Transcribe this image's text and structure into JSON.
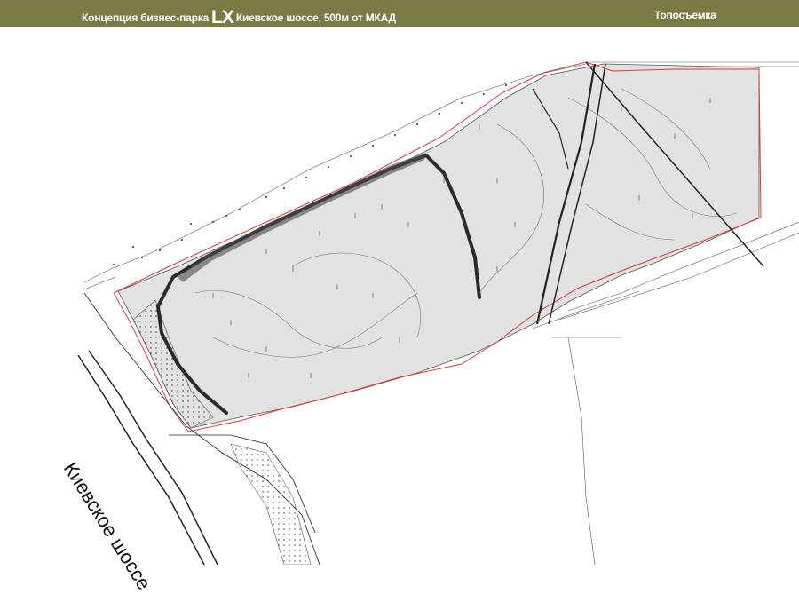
{
  "header": {
    "title_before": "Концепция бизнес-парка",
    "title_logo": "LX",
    "title_after": "Киевское шоссе, 500м от МКАД",
    "section": "Топосъемка",
    "background_color": "#7a7a45",
    "text_color": "#ffffff"
  },
  "map": {
    "road_label": "Киевское шоссе",
    "site_fill_color": "#e2e2e2",
    "boundary_color": "#e0393e",
    "line_color": "#333333"
  }
}
